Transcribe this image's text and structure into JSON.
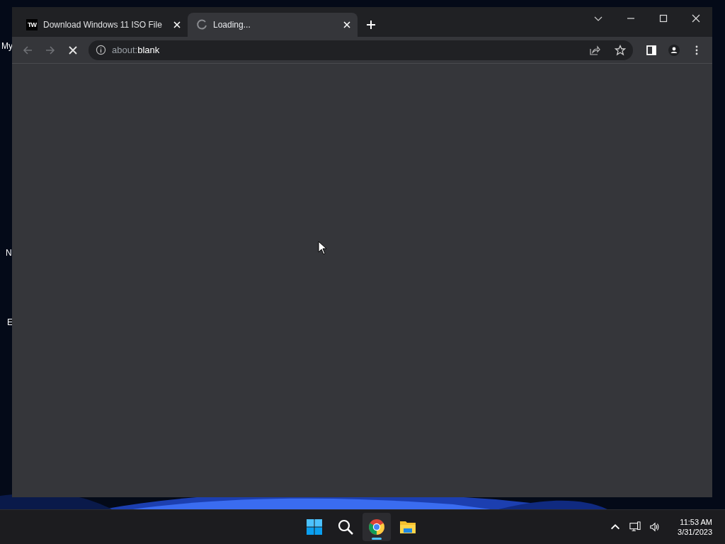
{
  "desktop": {
    "icon_labels": [
      "My",
      "N",
      "E"
    ]
  },
  "browser": {
    "tabs": [
      {
        "title": "Download Windows 11 ISO File",
        "favicon": "TW",
        "selected": false,
        "loading": false
      },
      {
        "title": "Loading...",
        "selected": true,
        "loading": true
      }
    ],
    "page_loading": true,
    "address": {
      "scheme": "about:",
      "rest": "blank"
    }
  },
  "taskbar": {
    "apps": [
      {
        "kind": "start",
        "active": false
      },
      {
        "kind": "search",
        "active": false
      },
      {
        "kind": "chrome",
        "active": true
      },
      {
        "kind": "files",
        "active": false
      }
    ],
    "time": "11:53 AM",
    "date": "3/31/2023"
  }
}
